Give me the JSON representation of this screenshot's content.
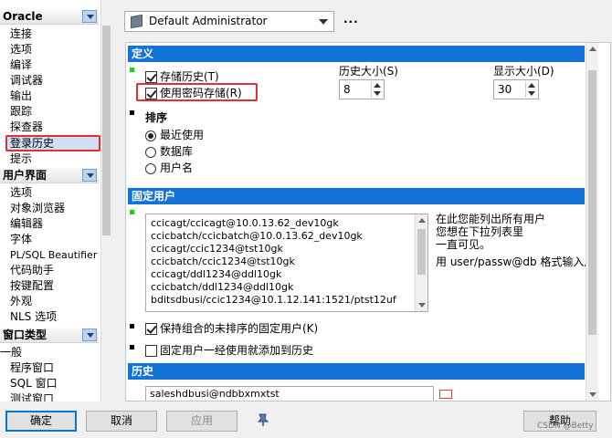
{
  "sidebar": {
    "category_oracle": "Oracle",
    "oracle_items": [
      "连接",
      "选项",
      "编译",
      "调试器",
      "输出",
      "跟踪",
      "探查器",
      "登录历史",
      "提示"
    ],
    "category_ui": "用户界面",
    "ui_items": [
      "选项",
      "对象浏览器",
      "编辑器",
      "字体",
      "PL/SQL Beautifier",
      "代码助手",
      "按键配置",
      "外观",
      "NLS 选项"
    ],
    "category_window": "窗口类型",
    "window_items": [
      "一般",
      "程序窗口",
      "SQL 窗口",
      "测试窗口"
    ]
  },
  "profile": {
    "selected": "Default Administrator",
    "more": "..."
  },
  "definition": {
    "header": "定义",
    "store_history": "存储历史(T)",
    "use_password": "使用密码存储(R)",
    "history_size_label": "历史大小(S)",
    "history_size_value": "8",
    "display_size_label": "显示大小(D)",
    "display_size_value": "30",
    "sort_label": "排序",
    "sort_options": [
      "最近使用",
      "数据库",
      "用户名"
    ]
  },
  "fixed_users": {
    "header": "固定用户",
    "rows": [
      "ccicagt/ccicagt@10.0.13.62_dev10gk",
      "ccicbatch/ccicbatch@10.0.13.62_dev10gk",
      "ccicagt/ccic1234@tst10gk",
      "ccicbatch/ccic1234@tst10gk",
      "ccicagt/ddl1234@ddl10gk",
      "ccicbatch/ddl1234@ddl10gk",
      "bditsdbusi/ccic1234@10.1.12.141:1521/ptst12uf"
    ],
    "hint_line1": "在此您能列出所有用户",
    "hint_line2": "您想在下拉列表里",
    "hint_line3": "一直可见。",
    "hint_line4": "用 user/passw@db 格式输入用",
    "keep_unsorted": "保持组合的未排序的固定用户(K)",
    "add_to_history": "固定用户一经使用就添加到历史"
  },
  "history": {
    "header": "历史",
    "first_entry": "saleshdbusi@ndbbxmxtst"
  },
  "buttons": {
    "ok": "确定",
    "cancel": "取消",
    "apply": "应用",
    "help": "帮助"
  },
  "watermark": "CSDN @Betty"
}
